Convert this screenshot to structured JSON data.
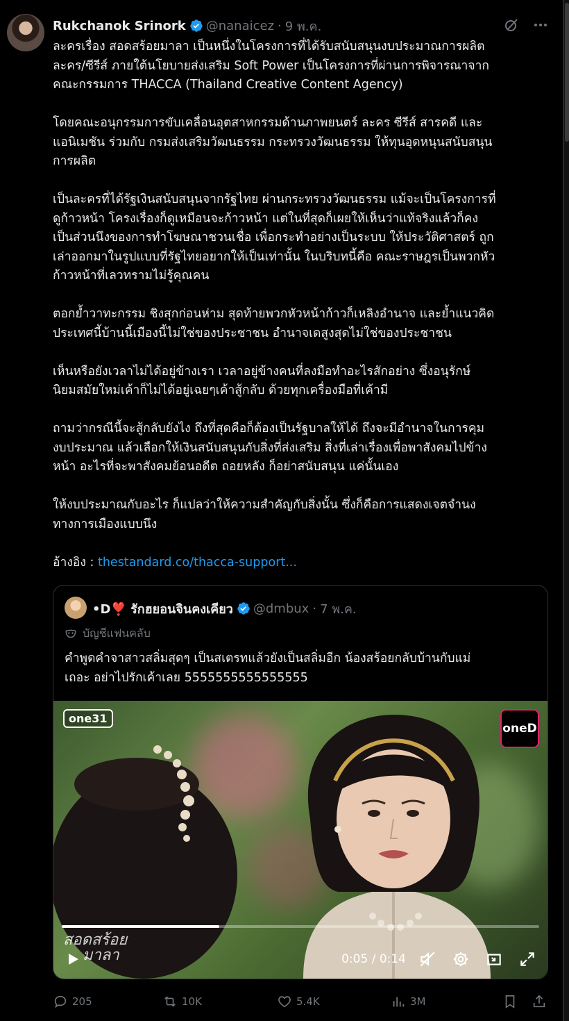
{
  "tweet": {
    "author_name": "Rukchanok Srinork",
    "handle": "@nanaicez",
    "date": "9 พ.ค.",
    "separator": "·",
    "paragraphs": [
      "ละครเรื่อง สอดสร้อยมาลา เป็นหนึ่งในโครงการที่ได้รับสนับสนุนงบประมาณการผลิต\nละคร/ซีรีส์ ภายใต้นโยบายส่งเสริม Soft Power เป็นโครงการที่ผ่านการพิจารณาจาก\nคณะกรรมการ THACCA (Thailand Creative Content Agency)",
      "โดยคณะอนุกรรมการขับเคลื่อนอุตสาหกรรมด้านภาพยนตร์ ละคร ซีรีส์ สารคดี และ\nแอนิเมชัน ร่วมกับ กรมส่งเสริมวัฒนธรรม กระทรวงวัฒนธรรม ให้ทุนอุดหนุนสนับสนุน\nการผลิต",
      "เป็นละครที่ได้รัฐเงินสนับสนุนจากรัฐไทย ผ่านกระทรวงวัฒนธรรม แม้จะเป็นโครงการที่\nดูก้าวหน้า โครงเรื่องก็ดูเหมือนจะก้าวหน้า แต่ในที่สุดก็เผยให้เห็นว่าแท้จริงแล้วก็คง\nเป็นส่วนนึงของการทำโฆษณาชวนเชื่อ เพื่อกระทำอย่างเป็นระบบ ให้ประวัติศาสตร์ ถูก\nเล่าออกมาในรูปแบบที่รัฐไทยอยากให้เป็นเท่านั้น ในบริบทนี้คือ คณะราษฎรเป็นพวกหัว\nก้าวหน้าที่เลวทรามไม่รู้คุณคน",
      "ตอกย้ำวาทะกรรม ชิงสุกก่อนห่าม สุดท้ายพวกหัวหน้าก้าวก็เหลิงอำนาจ และย้ำแนวคิด\nประเทศนี้บ้านนี้เมืองนี้ไม่ใช่ของประชาชน อำนาจเดสูงสุดไม่ใช่ของประชาชน",
      "เห็นหรือยังเวลาไม่ได้อยู่ข้างเรา เวลาอยู่ข้างคนที่ลงมือทำอะไรสักอย่าง ซึ่งอนุรักษ์\nนิยมสมัยใหม่เค้าก็ไม่ได้อยู่เฉยๆเค้าสู้กลับ ด้วยทุกเครื่องมือที่เค้ามี",
      "ถามว่ากรณีนี้จะสู้กลับยังไง ถึงที่สุดคือก็ต้องเป็นรัฐบาลให้ได้ ถึงจะมีอำนาจในการคุม\nงบประมาณ แล้วเลือกให้เงินสนับสนุนกับสิ่งที่ส่งเสริม สิ่งที่เล่าเรื่องเพื่อพาสังคมไปข้าง\nหน้า อะไรที่จะพาสังคมย้อนอดีต ถอยหลัง ก็อย่าสนับสนุน แค่นั้นเอง",
      "ให้งบประมาณกับอะไร ก็แปลว่าให้ความสำคัญกับสิ่งนั้น ซึ่งก็คือการแสดงเจตจำนง\nทางการเมืองแบบนึง"
    ],
    "reference_label": "อ้างอิง : ",
    "reference_link": "thestandard.co/thacca-support..."
  },
  "quote": {
    "author_name": "•D❣️ รักฮยอนจินคงเคียว",
    "handle": "@dmbux",
    "date": "7 พ.ค.",
    "separator": "·",
    "community_label": "บัญชีแฟนคลับ",
    "text": "คำพูดคำจาสาวสลิ่มสุดๆ เป็นสเตรทแล้วยังเป็นสลิ่มอีก น้องสร้อยกลับบ้านกับแม่\nเถอะ อย่าไปรักเค้าเลย 5555555555555555",
    "video": {
      "channel_logo": "one31",
      "brand_logo": "oneD",
      "watermark_line1": "สอดสร้อย",
      "watermark_line2": "มาลา",
      "time": "0:05 / 0:14",
      "progress": 0.33
    }
  },
  "actions": {
    "replies": "205",
    "reposts": "10K",
    "likes": "5.4K",
    "views": "3M"
  },
  "colors": {
    "background": "#000000",
    "text": "#e7e9ea",
    "muted": "#71767b",
    "link": "#1d9bf0",
    "verified": "#1d9bf0",
    "border": "#2f3336"
  }
}
